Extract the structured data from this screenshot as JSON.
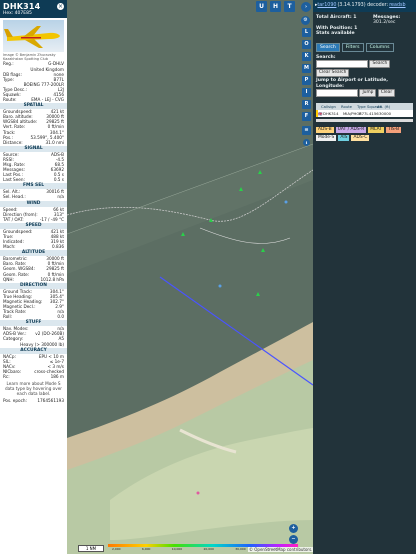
{
  "aircraft": {
    "callsign": "DHK314",
    "hex_label": "Hex: 407E85",
    "image_credit": "Image © Benjamin Zhuravsky Kazakhstan Spotting Club",
    "fields": [
      {
        "label": "Reg.:",
        "value": "G-DHLV"
      },
      {
        "label": "",
        "value": "United Kingdom"
      },
      {
        "label": "DB flags:",
        "value": "none"
      },
      {
        "label": "Type:",
        "value": "B77L"
      },
      {
        "label": "",
        "value": "BOEING 777-200LR"
      },
      {
        "label": "Type Desc.:",
        "value": "L2J"
      },
      {
        "label": "Squawk:",
        "value": "4156"
      },
      {
        "label": "Route:",
        "value": "EMA - LEJ - CVG"
      }
    ]
  },
  "sections": {
    "spatial": "SPATIAL",
    "signal": "SIGNAL",
    "fms": "FMS SEL",
    "wind": "WIND",
    "speed": "SPEED",
    "altitude": "ALTITUDE",
    "direction": "DIRECTION",
    "stuff": "STUFF",
    "accuracy": "ACCURACY"
  },
  "spatial": [
    {
      "label": "Groundspeed:",
      "value": "421 kt"
    },
    {
      "label": "Baro. altitude:",
      "value": "30000 ft"
    },
    {
      "label": "WGS84 altitude:",
      "value": "29825 ft"
    },
    {
      "label": "Vert. Rate:",
      "value": "0 ft/min"
    },
    {
      "label": "Track:",
      "value": "304.1°"
    },
    {
      "label": "Pos.:",
      "value": "53.599°, 5.400°"
    },
    {
      "label": "Distance:",
      "value": "31.0 nmi"
    }
  ],
  "signal": [
    {
      "label": "Source:",
      "value": "ADS-B"
    },
    {
      "label": "RSSI:",
      "value": "-4.5"
    },
    {
      "label": "Msg. Rate:",
      "value": "68.5"
    },
    {
      "label": "Messages:",
      "value": "63692"
    },
    {
      "label": "Last Pos.:",
      "value": "0.5 s"
    },
    {
      "label": "Last Seen:",
      "value": "0.5 s"
    }
  ],
  "fms": [
    {
      "label": "Sel. Alt.:",
      "value": "30016 ft"
    },
    {
      "label": "Sel. Head.:",
      "value": "n/a"
    }
  ],
  "wind": [
    {
      "label": "Speed:",
      "value": "66 kt"
    },
    {
      "label": "Direction (from):",
      "value": "313°"
    },
    {
      "label": "TAT / OAT:",
      "value": "-17 / -49 °C"
    }
  ],
  "speed": [
    {
      "label": "Groundspeed:",
      "value": "421 kt"
    },
    {
      "label": "True:",
      "value": "488 kt"
    },
    {
      "label": "Indicated:",
      "value": "319 kt"
    },
    {
      "label": "Mach:",
      "value": "0.836"
    }
  ],
  "altitude": [
    {
      "label": "Barometric:",
      "value": "30000 ft"
    },
    {
      "label": "Baro. Rate:",
      "value": "0 ft/min"
    },
    {
      "label": "Geom. WGS84:",
      "value": "29825 ft"
    },
    {
      "label": "Geom. Rate:",
      "value": "0 ft/min"
    },
    {
      "label": "QNH:",
      "value": "1012.8 hPa"
    }
  ],
  "direction": [
    {
      "label": "Ground Track:",
      "value": "304.1°"
    },
    {
      "label": "True Heading:",
      "value": "305.4°"
    },
    {
      "label": "Magnetic Heading:",
      "value": "302.7°"
    },
    {
      "label": "Magnetic Decl.:",
      "value": "2.9°"
    },
    {
      "label": "Track Rate:",
      "value": "n/a"
    },
    {
      "label": "Roll:",
      "value": "0.0"
    }
  ],
  "stuff": [
    {
      "label": "Nav. Modes:",
      "value": "n/a"
    },
    {
      "label": "ADS-B Ver.:",
      "value": "v2 (DO-260B)"
    },
    {
      "label": "Category:",
      "value": "A5"
    },
    {
      "label": "",
      "value": "Heavy (> 300000 lb)"
    }
  ],
  "accuracy": [
    {
      "label": "NACp:",
      "value": "EPU < 10 m"
    },
    {
      "label": "SIL:",
      "value": "≤ 1e-7"
    },
    {
      "label": "NACv:",
      "value": "< 3 m/s"
    },
    {
      "label": "NICbaro:",
      "value": "cross-checked"
    },
    {
      "label": "Rc:",
      "value": "186 m"
    }
  ],
  "learn_more": "Learn more about Mode S data type by hovering over each data label.",
  "pos_epoch": {
    "label": "Pos. epoch:",
    "value": "1764561193"
  },
  "header": {
    "link": "tar1090",
    "version": "(3.14.1793) decoder:",
    "decoder_link": "readsb"
  },
  "stats": {
    "total_label": "Total Aircraft: 1",
    "messages_label": "Messages:",
    "messages_value": "301.2/sec",
    "with_pos": "With Position: 1",
    "stats_link": "Stats available"
  },
  "tabs": [
    "Search",
    "Filters",
    "Columns"
  ],
  "search": {
    "label": "Search:",
    "search_btn": "Search",
    "clear_btn": "Clear Search",
    "jump_label": "Jump to Airport or Latitude, Longitude:",
    "jump_btn": "Jump",
    "clear2_btn": "Clear"
  },
  "table": {
    "headers": [
      "",
      "Callsign",
      "Route",
      "Type",
      "Squawk",
      "Alt. (ft)"
    ],
    "row": {
      "flag": "🇬🇧",
      "callsign": "DHK314",
      "route": "MIA/PHOF",
      "type": "B77L",
      "squawk": "4156",
      "alt": "30000"
    }
  },
  "legend": [
    "ADS-B",
    "UAT / ADS-R",
    "MLAT",
    "TIS-B",
    "Mode-S",
    "AIS",
    "ADS-C"
  ],
  "legend_colors": [
    "#ffd27a",
    "#c7a8e8",
    "#f0d060",
    "#f5a07a",
    "#f0f0f0",
    "#6fcfe0",
    "#ffe0a0"
  ],
  "map_buttons": [
    "U",
    "H",
    "T"
  ],
  "side_buttons": [
    "L",
    "O",
    "K",
    "M",
    "P",
    "I",
    "R",
    "F"
  ],
  "zoom": {
    "plus": "+",
    "minus": "−"
  },
  "scale": {
    "distance": "1 NM",
    "ticks": [
      "2,000",
      "6,000",
      "10,000",
      "20,000",
      "30,000",
      "40,000+"
    ]
  },
  "attribution": "© OpenStreetMap contributors."
}
